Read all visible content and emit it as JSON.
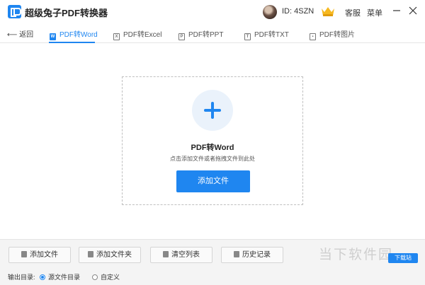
{
  "app": {
    "title": "超级兔子PDF转换器"
  },
  "user": {
    "id_text": "ID: 4SZN"
  },
  "topbar": {
    "service": "客服",
    "menu": "菜单"
  },
  "nav": {
    "back": "返回",
    "tabs": [
      {
        "label": "PDF转Word",
        "icon": "W",
        "active": true
      },
      {
        "label": "PDF转Excel",
        "icon": "X",
        "active": false
      },
      {
        "label": "PDF转PPT",
        "icon": "P",
        "active": false
      },
      {
        "label": "PDF转TXT",
        "icon": "T",
        "active": false
      },
      {
        "label": "PDF转图片",
        "icon": "▪",
        "active": false
      }
    ]
  },
  "dropzone": {
    "title": "PDF转Word",
    "hint": "点击添加文件或者拖拽文件到此处",
    "button": "添加文件"
  },
  "bottom": {
    "buttons": [
      "添加文件",
      "添加文件夹",
      "清空列表",
      "历史记录"
    ],
    "output_label": "输出目录:",
    "radio_source": "源文件目录",
    "radio_custom": "自定义"
  },
  "watermark": {
    "text": "当下软件园",
    "badge": "下载站"
  },
  "colors": {
    "accent": "#1f86f0"
  }
}
